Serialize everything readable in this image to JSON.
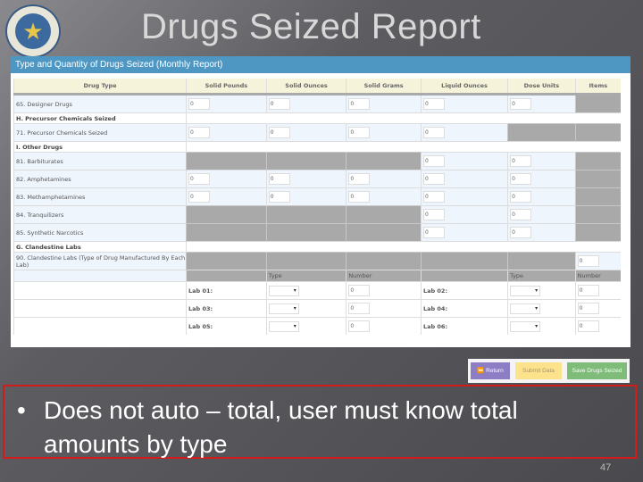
{
  "slide": {
    "title": "Drugs Seized Report",
    "bullet": "Does not auto – total, user must know total amounts by type",
    "page_number": "47"
  },
  "panel": {
    "header": "Type and Quantity of Drugs Seized (Monthly Report)",
    "columns": [
      "Drug Type",
      "Solid Pounds",
      "Solid Ounces",
      "Solid Grams",
      "Liquid Ounces",
      "Dose Units",
      "Items"
    ],
    "rows": [
      {
        "kind": "data",
        "label": "65. Designer Drugs",
        "cells": [
          "0",
          "0",
          "0",
          "0",
          "0",
          null
        ]
      },
      {
        "kind": "section",
        "label": "H. Precursor Chemicals Seized"
      },
      {
        "kind": "data",
        "label": "71. Precursor Chemicals Seized",
        "cells": [
          "0",
          "0",
          "0",
          "0",
          null,
          null
        ]
      },
      {
        "kind": "section",
        "label": "I. Other Drugs"
      },
      {
        "kind": "data",
        "label": "81. Barbiturates",
        "cells": [
          null,
          null,
          null,
          "0",
          "0",
          null
        ]
      },
      {
        "kind": "data",
        "label": "82. Amphetamines",
        "cells": [
          "0",
          "0",
          "0",
          "0",
          "0",
          null
        ]
      },
      {
        "kind": "data",
        "label": "83. Methamphetamines",
        "cells": [
          "0",
          "0",
          "0",
          "0",
          "0",
          null
        ]
      },
      {
        "kind": "data",
        "label": "84. Tranquilizers",
        "cells": [
          null,
          null,
          null,
          "0",
          "0",
          null
        ]
      },
      {
        "kind": "data",
        "label": "85. Synthetic Narcotics",
        "cells": [
          null,
          null,
          null,
          "0",
          "0",
          null
        ]
      },
      {
        "kind": "section",
        "label": "G. Clandestine Labs"
      },
      {
        "kind": "data",
        "label": "90. Clandestine Labs (Type of Drug Manufactured By Each Lab)",
        "cells": [
          null,
          null,
          null,
          null,
          null,
          "0"
        ]
      }
    ],
    "lab_subheader": {
      "type": "Type",
      "number": "Number"
    },
    "labs": [
      {
        "left": {
          "label": "Lab 01:",
          "type": "",
          "number": "0"
        },
        "right": {
          "label": "Lab 02:",
          "type": "",
          "number": "0"
        }
      },
      {
        "left": {
          "label": "Lab 03:",
          "type": "",
          "number": "0"
        },
        "right": {
          "label": "Lab 04:",
          "type": "",
          "number": "0"
        }
      },
      {
        "left": {
          "label": "Lab 05:",
          "type": "",
          "number": "0"
        },
        "right": {
          "label": "Lab 06:",
          "type": "",
          "number": "0"
        }
      }
    ]
  },
  "buttons": {
    "return": "⏪ Return",
    "submit": "Submit Data",
    "save": "Save Drugs Seized"
  },
  "colors": {
    "header_blue": "#4f97c3",
    "return": "#8c7dc4",
    "submit": "#fde28c",
    "save": "#7fbc7a",
    "highlight_border": "#d21c1c"
  }
}
